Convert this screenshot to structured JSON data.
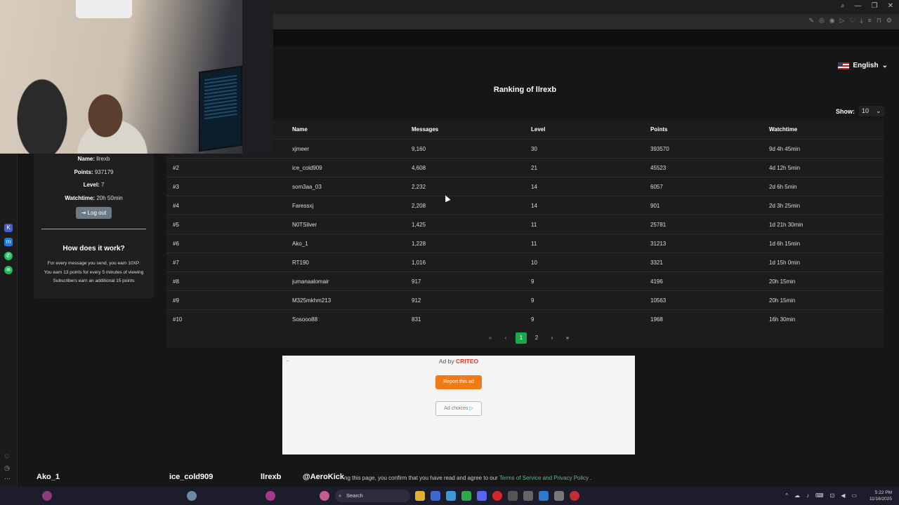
{
  "browser": {
    "language": "English",
    "window_controls": [
      "search-icon",
      "minimize-icon",
      "restore-icon",
      "close-icon"
    ]
  },
  "user_card": {
    "name_label": "Name:",
    "name_value": "llrexb",
    "points_label": "Points:",
    "points_value": "937179",
    "level_label": "Level:",
    "level_value": "7",
    "watchtime_label": "Watchtime:",
    "watchtime_value": "20h 50min",
    "logout_label": "Log out",
    "how_title": "How does it work?",
    "how_lines": [
      "For every message you send, you earn 10XP.",
      "You earn 13 points for every 5 minutes of viewing",
      "Subscribers earn an additional 15 points"
    ]
  },
  "ranking": {
    "title": "Ranking of llrexb",
    "show_label": "Show:",
    "show_value": "10",
    "columns": [
      "Name",
      "Messages",
      "Level",
      "Points",
      "Watchtime"
    ],
    "rows": [
      {
        "rank": "",
        "name": "xjmeer",
        "messages": "9,160",
        "level": "30",
        "points": "393570",
        "watchtime": "9d 4h 45min"
      },
      {
        "rank": "#2",
        "name": "ice_cold909",
        "messages": "4,608",
        "level": "21",
        "points": "45523",
        "watchtime": "4d 12h 5min"
      },
      {
        "rank": "#3",
        "name": "som3aa_03",
        "messages": "2,232",
        "level": "14",
        "points": "6057",
        "watchtime": "2d 6h 5min"
      },
      {
        "rank": "#4",
        "name": "Faressxj",
        "messages": "2,208",
        "level": "14",
        "points": "901",
        "watchtime": "2d 3h 25min"
      },
      {
        "rank": "#5",
        "name": "N0TSilver",
        "messages": "1,425",
        "level": "11",
        "points": "25781",
        "watchtime": "1d 21h 30min"
      },
      {
        "rank": "#6",
        "name": "Ako_1",
        "messages": "1,228",
        "level": "11",
        "points": "31213",
        "watchtime": "1d 6h 15min"
      },
      {
        "rank": "#7",
        "name": "RT190",
        "messages": "1,016",
        "level": "10",
        "points": "3321",
        "watchtime": "1d 15h 0min"
      },
      {
        "rank": "#8",
        "name": "jumanaalomair",
        "messages": "917",
        "level": "9",
        "points": "4196",
        "watchtime": "20h 15min"
      },
      {
        "rank": "#9",
        "name": "M325mkhm213",
        "messages": "912",
        "level": "9",
        "points": "10563",
        "watchtime": "20h 15min"
      },
      {
        "rank": "#10",
        "name": "Sosooo88",
        "messages": "831",
        "level": "9",
        "points": "1968",
        "watchtime": "16h 30min"
      }
    ],
    "pagination": {
      "first": "«",
      "prev": "‹",
      "pages": [
        "1",
        "2"
      ],
      "current": "1",
      "next": "›",
      "last": "»"
    }
  },
  "ad": {
    "ad_by": "Ad by",
    "brand": "CRITEO",
    "report_label": "Report this ad",
    "choices_label": "Ad choices"
  },
  "footer": {
    "consent_text": "ng this page, you confirm that you have read and agree to our",
    "consent_link": "Terms of Service and Privacy Policy",
    "consent_end": "."
  },
  "stream_overlay": {
    "names": [
      "Ako_1",
      "ice_cold909",
      "llrexb",
      "@AeroKick"
    ]
  },
  "taskbar": {
    "search_placeholder": "Search",
    "time": "5:22 PM",
    "date": "11/16/2025"
  },
  "colors": {
    "accent_green": "#19a84a",
    "ad_orange": "#f07b16",
    "criteo_red": "#e03a2e"
  }
}
